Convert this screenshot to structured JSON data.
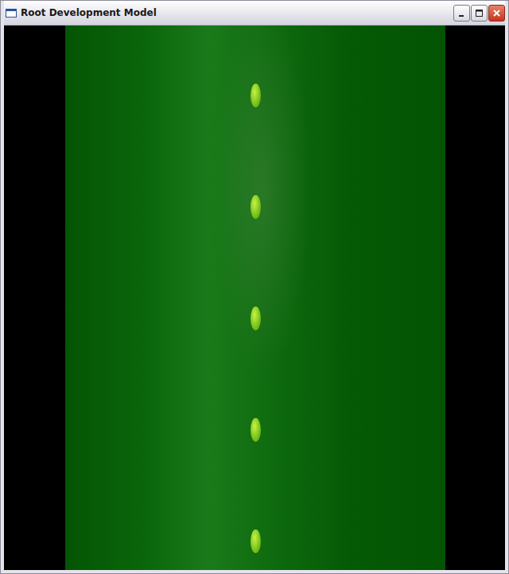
{
  "window": {
    "title": "Root Development Model",
    "controls": [
      {
        "kind": "minimize"
      },
      {
        "kind": "maximize"
      },
      {
        "kind": "close"
      }
    ]
  },
  "nodes": [
    {
      "kind": "primordium"
    },
    {
      "kind": "primordium"
    },
    {
      "kind": "primordium"
    },
    {
      "kind": "primordium"
    },
    {
      "kind": "primordium"
    }
  ]
}
